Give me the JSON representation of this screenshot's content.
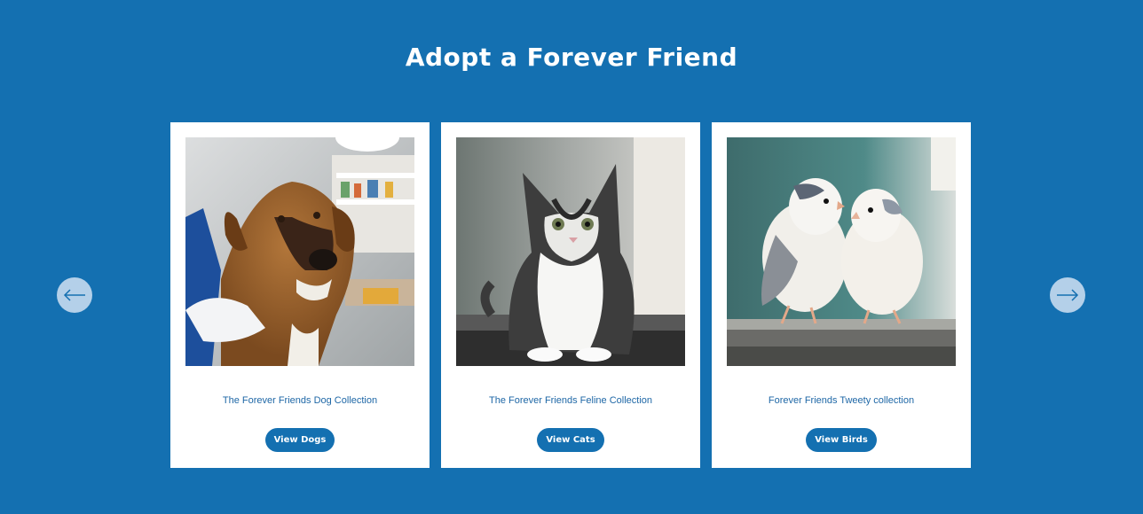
{
  "heading": "Adopt a Forever Friend",
  "carousel": {
    "prev_icon": "arrow-left-icon",
    "next_icon": "arrow-right-icon",
    "cards": [
      {
        "image": "dog-photo",
        "caption": "The Forever Friends Dog Collection",
        "button": "View Dogs"
      },
      {
        "image": "kitten-photo",
        "caption": "The Forever Friends Feline Collection",
        "button": "View Cats"
      },
      {
        "image": "birds-photo",
        "caption": "Forever Friends Tweety collection",
        "button": "View Birds"
      }
    ]
  },
  "colors": {
    "background": "#1470b1",
    "card": "#ffffff",
    "button": "#1470b1",
    "caption": "#1e67a6",
    "arrow_bg": "#b4d0e9"
  }
}
